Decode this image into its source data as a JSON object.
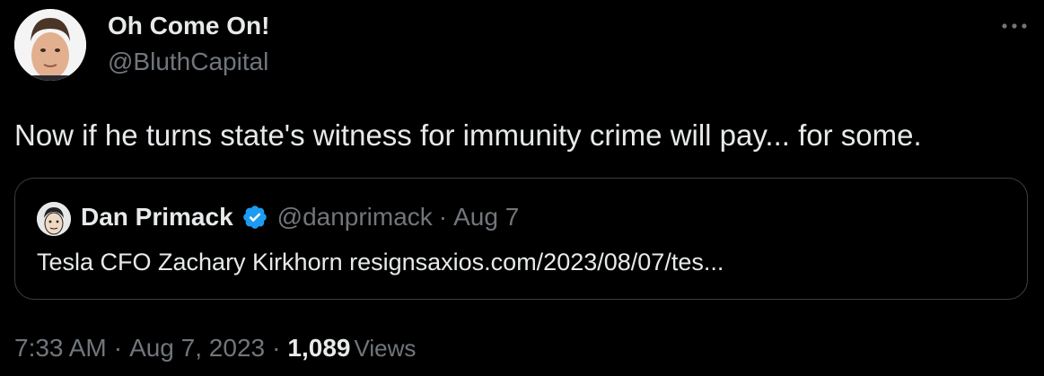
{
  "author": {
    "name": "Oh Come On!",
    "handle": "@BluthCapital"
  },
  "tweet": {
    "text": "Now if he turns state's witness for immunity crime will pay... for some."
  },
  "quote": {
    "name": "Dan Primack",
    "handle": "@danprimack",
    "separator": "·",
    "date": "Aug 7",
    "text": "Tesla CFO Zachary Kirkhorn resigns",
    "link": "axios.com/2023/08/07/tes..."
  },
  "footer": {
    "time": "7:33 AM",
    "separator": "·",
    "date": "Aug 7, 2023",
    "views_count": "1,089",
    "views_label": "Views"
  },
  "colors": {
    "background": "#000000",
    "primary_text": "#e7e9ea",
    "secondary_text": "#71767b",
    "verified_blue": "#1d9bf0",
    "border": "#3a3e42"
  },
  "icons": {
    "more": "more-horizontal-icon",
    "verified": "verified-badge-icon"
  }
}
